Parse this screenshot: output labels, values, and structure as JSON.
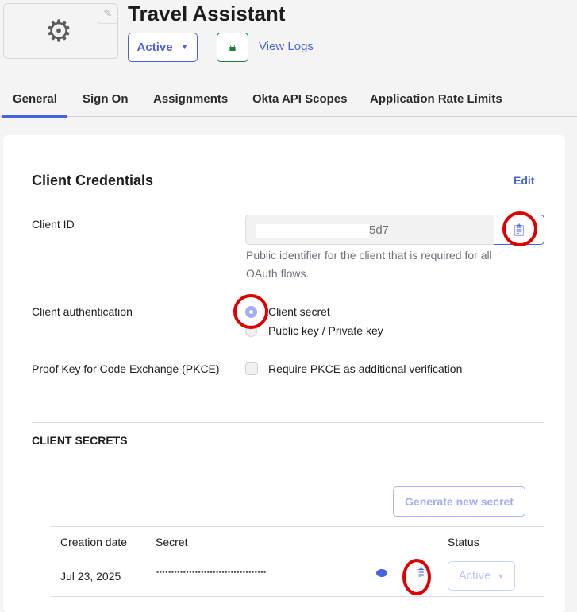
{
  "header": {
    "title": "Travel Assistant",
    "status_label": "Active",
    "view_logs": "View Logs"
  },
  "tabs": [
    "General",
    "Sign On",
    "Assignments",
    "Okta API Scopes",
    "Application Rate Limits"
  ],
  "credentials": {
    "title": "Client Credentials",
    "edit": "Edit",
    "client_id_label": "Client ID",
    "client_id_value": "5d7",
    "client_id_help": "Public identifier for the client that is required for all OAuth flows.",
    "auth_label": "Client authentication",
    "auth_options": [
      "Client secret",
      "Public key / Private key"
    ],
    "auth_selected": "Client secret",
    "pkce_label": "Proof Key for Code Exchange (PKCE)",
    "pkce_option": "Require PKCE as additional verification",
    "pkce_checked": false
  },
  "secrets": {
    "title": "CLIENT SECRETS",
    "generate": "Generate new secret",
    "columns": [
      "Creation date",
      "Secret",
      "Status"
    ],
    "rows": [
      {
        "date": "Jul 23, 2025",
        "secret": "•••••••••••••••••••••••••••••••••••••",
        "status": "Active"
      }
    ]
  },
  "colors": {
    "accent": "#4a62e0",
    "green": "#1d7a3e",
    "annotation": "#e00000"
  }
}
